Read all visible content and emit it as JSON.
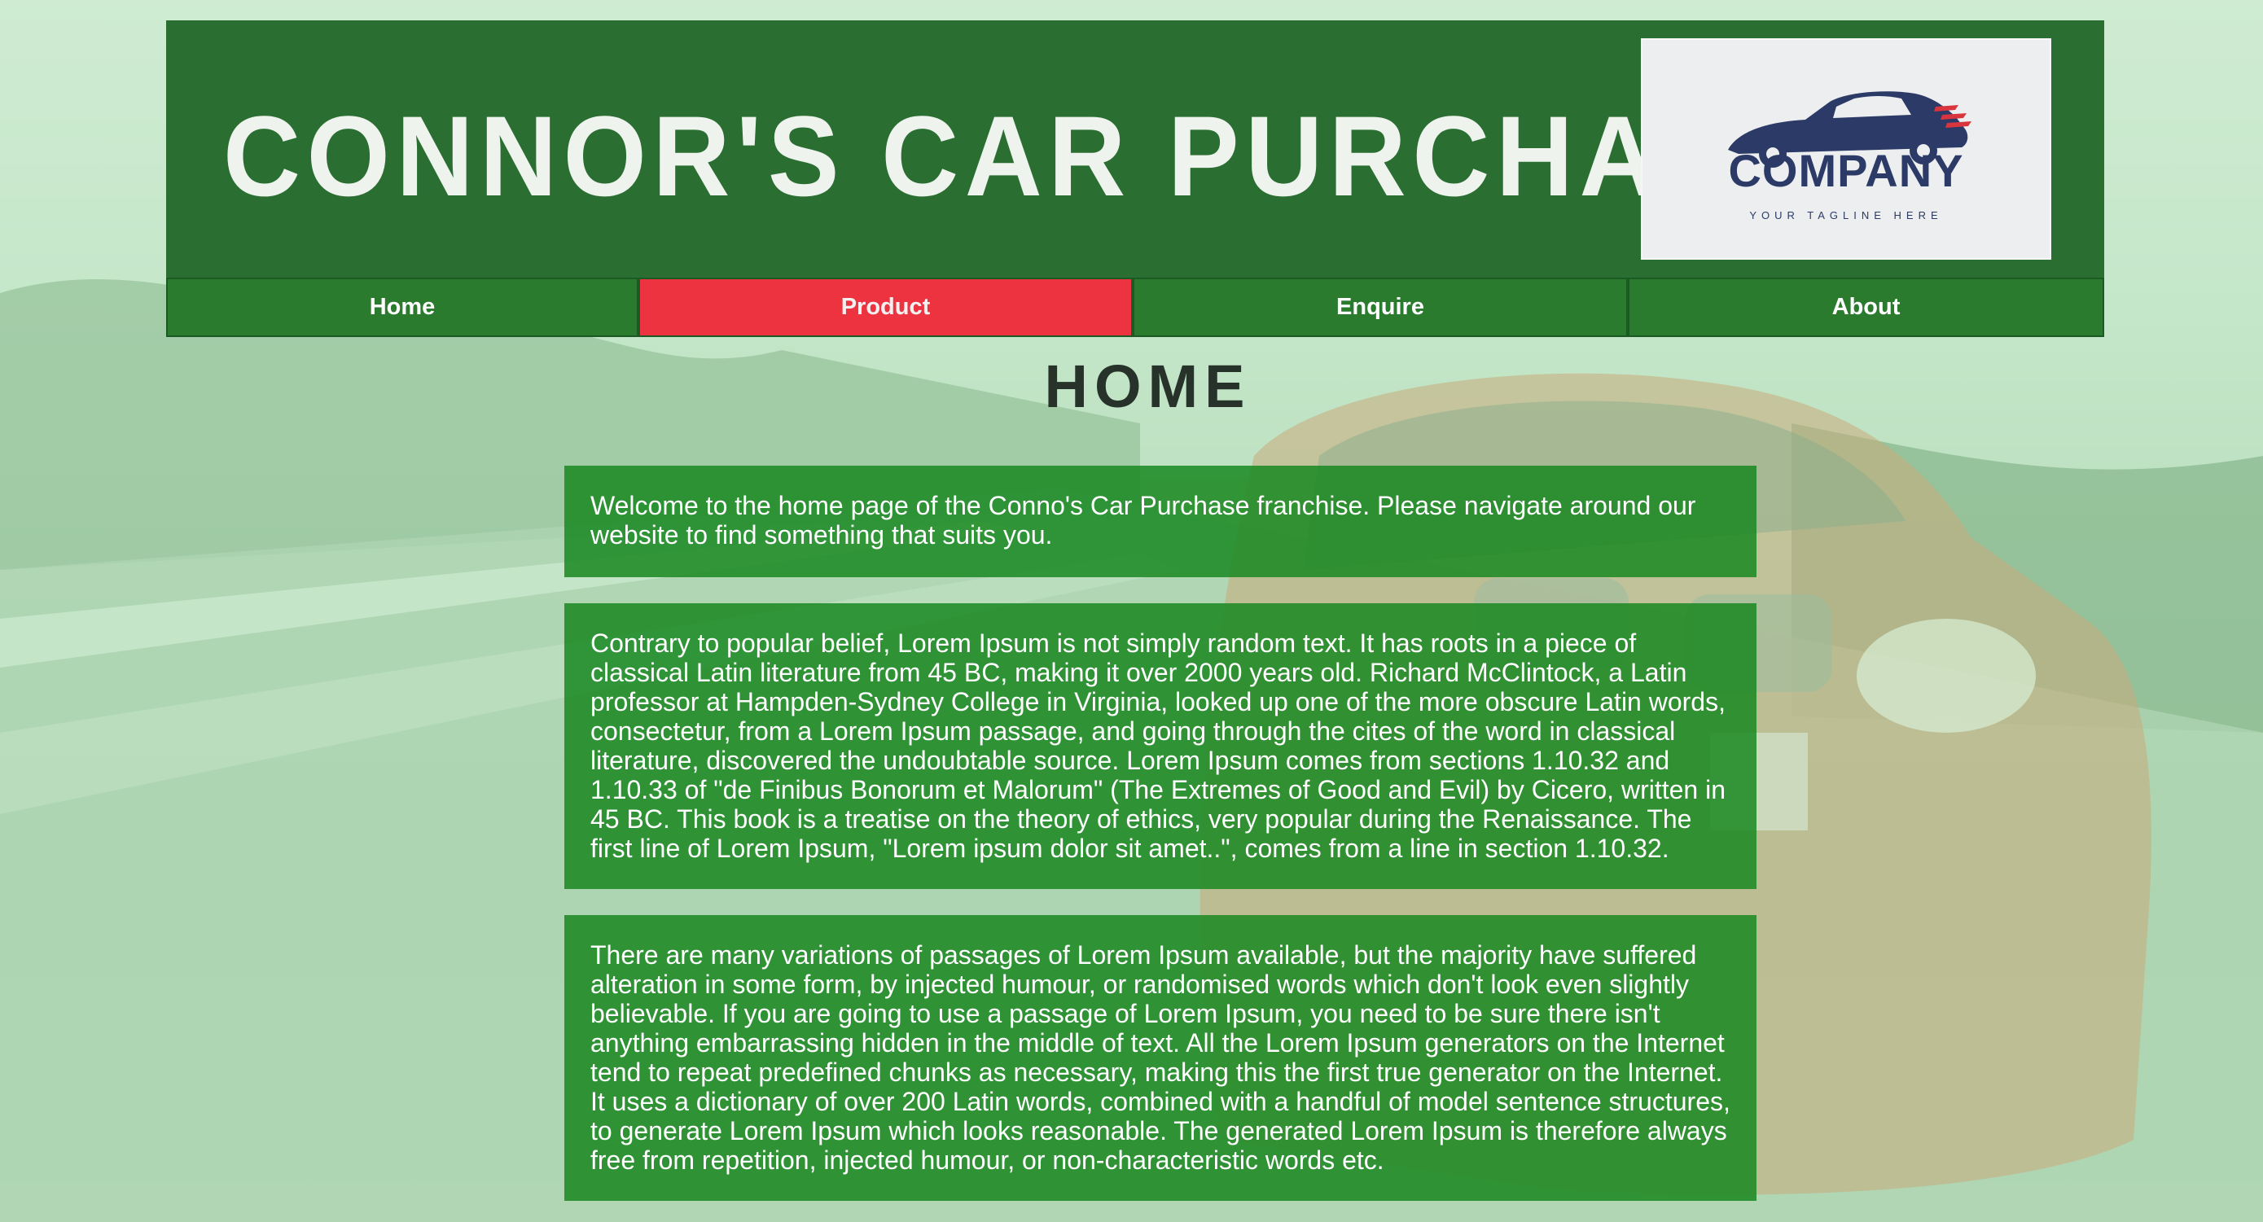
{
  "colors": {
    "header_bg": "#1e6426",
    "nav_bg": "#2a7b2e",
    "nav_active_bg": "#ee3340",
    "content_bg": "#1a8822",
    "title_text": "#eef3ee",
    "heading_text": "#26322a",
    "logo_text": "#2b3a67"
  },
  "header": {
    "title": "CONNOR'S CAR PURCHASE",
    "logo": {
      "icon": "car-logo-icon",
      "word": "COMPANY",
      "tagline": "YOUR TAGLINE HERE"
    }
  },
  "nav": {
    "items": [
      {
        "label": "Home",
        "active": false
      },
      {
        "label": "Product",
        "active": true
      },
      {
        "label": "Enquire",
        "active": false
      },
      {
        "label": "About",
        "active": false
      }
    ]
  },
  "main": {
    "heading": "HOME",
    "paragraphs": [
      "Welcome to the home page of the Conno's Car Purchase franchise. Please navigate around our website to find something that suits you.",
      "Contrary to popular belief, Lorem Ipsum is not simply random text. It has roots in a piece of classical Latin literature from 45 BC, making it over 2000 years old. Richard McClintock, a Latin professor at Hampden-Sydney College in Virginia, looked up one of the more obscure Latin words, consectetur, from a Lorem Ipsum passage, and going through the cites of the word in classical literature, discovered the undoubtable source. Lorem Ipsum comes from sections 1.10.32 and 1.10.33 of \"de Finibus Bonorum et Malorum\" (The Extremes of Good and Evil) by Cicero, written in 45 BC. This book is a treatise on the theory of ethics, very popular during the Renaissance. The first line of Lorem Ipsum, \"Lorem ipsum dolor sit amet..\", comes from a line in section 1.10.32.",
      "There are many variations of passages of Lorem Ipsum available, but the majority have suffered alteration in some form, by injected humour, or randomised words which don't look even slightly believable. If you are going to use a passage of Lorem Ipsum, you need to be sure there isn't anything embarrassing hidden in the middle of text. All the Lorem Ipsum generators on the Internet tend to repeat predefined chunks as necessary, making this the first true generator on the Internet. It uses a dictionary of over 200 Latin words, combined with a handful of model sentence structures, to generate Lorem Ipsum which looks reasonable. The generated Lorem Ipsum is therefore always free from repetition, injected humour, or non-characteristic words etc."
    ]
  }
}
